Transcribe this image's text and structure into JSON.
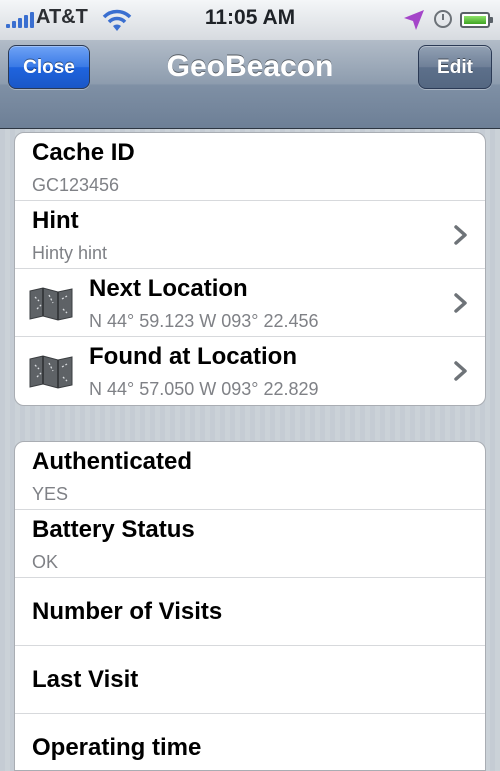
{
  "status_bar": {
    "carrier": "AT&T",
    "time": "11:05 AM"
  },
  "nav": {
    "close_label": "Close",
    "title": "GeoBeacon",
    "edit_label": "Edit"
  },
  "group1": [
    {
      "title": "Cache ID",
      "subtitle": "GC123456"
    },
    {
      "title": "Hint",
      "subtitle": "Hinty hint"
    },
    {
      "title": "Next Location",
      "subtitle": "N 44° 59.123 W 093° 22.456"
    },
    {
      "title": "Found at Location",
      "subtitle": "N 44° 57.050 W 093° 22.829"
    }
  ],
  "group2": [
    {
      "title": "Authenticated",
      "subtitle": "YES"
    },
    {
      "title": "Battery Status",
      "subtitle": "OK"
    },
    {
      "title": "Number of Visits"
    },
    {
      "title": "Last Visit"
    },
    {
      "title": "Operating time"
    }
  ],
  "colors": {
    "nav_bar": "#7f90a5",
    "close_button": "#1f64de",
    "background": "#c5ccd4"
  },
  "icons": {
    "status": [
      "signal-icon",
      "wifi-icon",
      "location-arrow-icon",
      "alarm-clock-icon",
      "battery-icon"
    ],
    "rows": [
      "map-icon",
      "chevron-right-icon"
    ]
  }
}
